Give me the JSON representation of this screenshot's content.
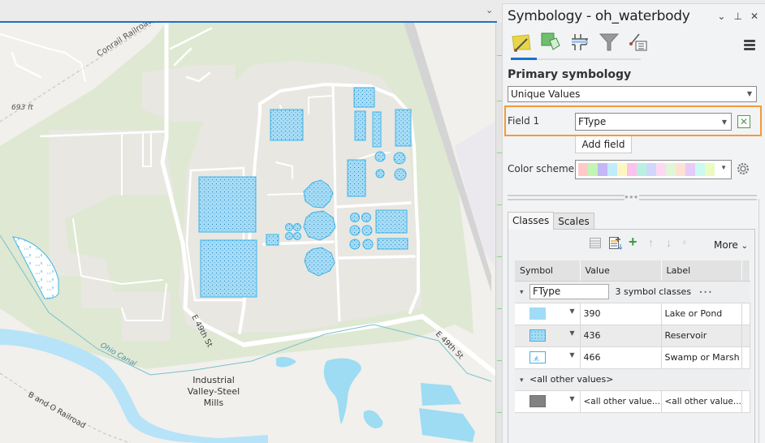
{
  "map": {
    "labels": {
      "railroad_top": "Conrail Railroad",
      "elevation": "693 ft",
      "street1": "E 49th St",
      "street2": "E 49th St",
      "canal": "Ohio Canal",
      "place_line1": "Industrial",
      "place_line2": "Valley-Steel",
      "place_line3": "Mills",
      "railroad_bottom": "B and O Railroad"
    },
    "colors": {
      "land": "#f1f0ec",
      "green": "#dfe8d2",
      "developed": "#e8e7e2",
      "road": "#ffffff",
      "water": "#9ddcf3",
      "river": "#b6e3f8",
      "reservoir_fill": "#a7dcf5",
      "reservoir_stroke": "#3cb4e5"
    }
  },
  "panel": {
    "title": "Symbology - oh_waterbody",
    "controls": {
      "options": "⌄",
      "pin": "⊥",
      "close": "✕"
    },
    "tool_tabs": [
      {
        "name": "primary-symbology",
        "icon": "paintbrush-polygon-icon",
        "active": true
      },
      {
        "name": "vary-symbology",
        "icon": "vary-symbology-icon",
        "active": false
      },
      {
        "name": "symbol-layer-drawing",
        "icon": "symbol-layer-drawing-icon",
        "active": false
      },
      {
        "name": "symbology-filter",
        "icon": "funnel-icon",
        "active": false
      },
      {
        "name": "label-symbology",
        "icon": "brush-list-icon",
        "active": false
      }
    ],
    "section_title": "Primary symbology",
    "renderer": "Unique Values",
    "field1_label": "Field 1",
    "field1_value": "FType",
    "add_field": "Add field",
    "color_scheme_label": "Color scheme",
    "color_scheme": [
      "#ffc9c9",
      "#c2f5b3",
      "#c4b7f7",
      "#c1ecfb",
      "#fdf6c0",
      "#fcc2ee",
      "#b8f1df",
      "#cfd7fb",
      "#fdd9f2",
      "#e1f6d6",
      "#fde2d3",
      "#e6cbf8",
      "#cafaf2",
      "#ecfbc0"
    ],
    "class_tabs": [
      "Classes",
      "Scales"
    ],
    "more_label": "More",
    "columns": [
      "Symbol",
      "Value",
      "Label"
    ],
    "group": {
      "name": "FType",
      "summary": "3 symbol classes",
      "ellipsis": "•••"
    },
    "rows": [
      {
        "symbol": "solid-light-blue",
        "value": "390",
        "label": "Lake or Pond"
      },
      {
        "symbol": "dotted-blue",
        "value": "436",
        "label": "Reservoir"
      },
      {
        "symbol": "marsh-pattern",
        "value": "466",
        "label": "Swamp or Marsh"
      }
    ],
    "other_group": "<all other values>",
    "other_row": {
      "symbol": "solid-gray",
      "value": "<all other value...",
      "label": "<all other value..."
    }
  }
}
